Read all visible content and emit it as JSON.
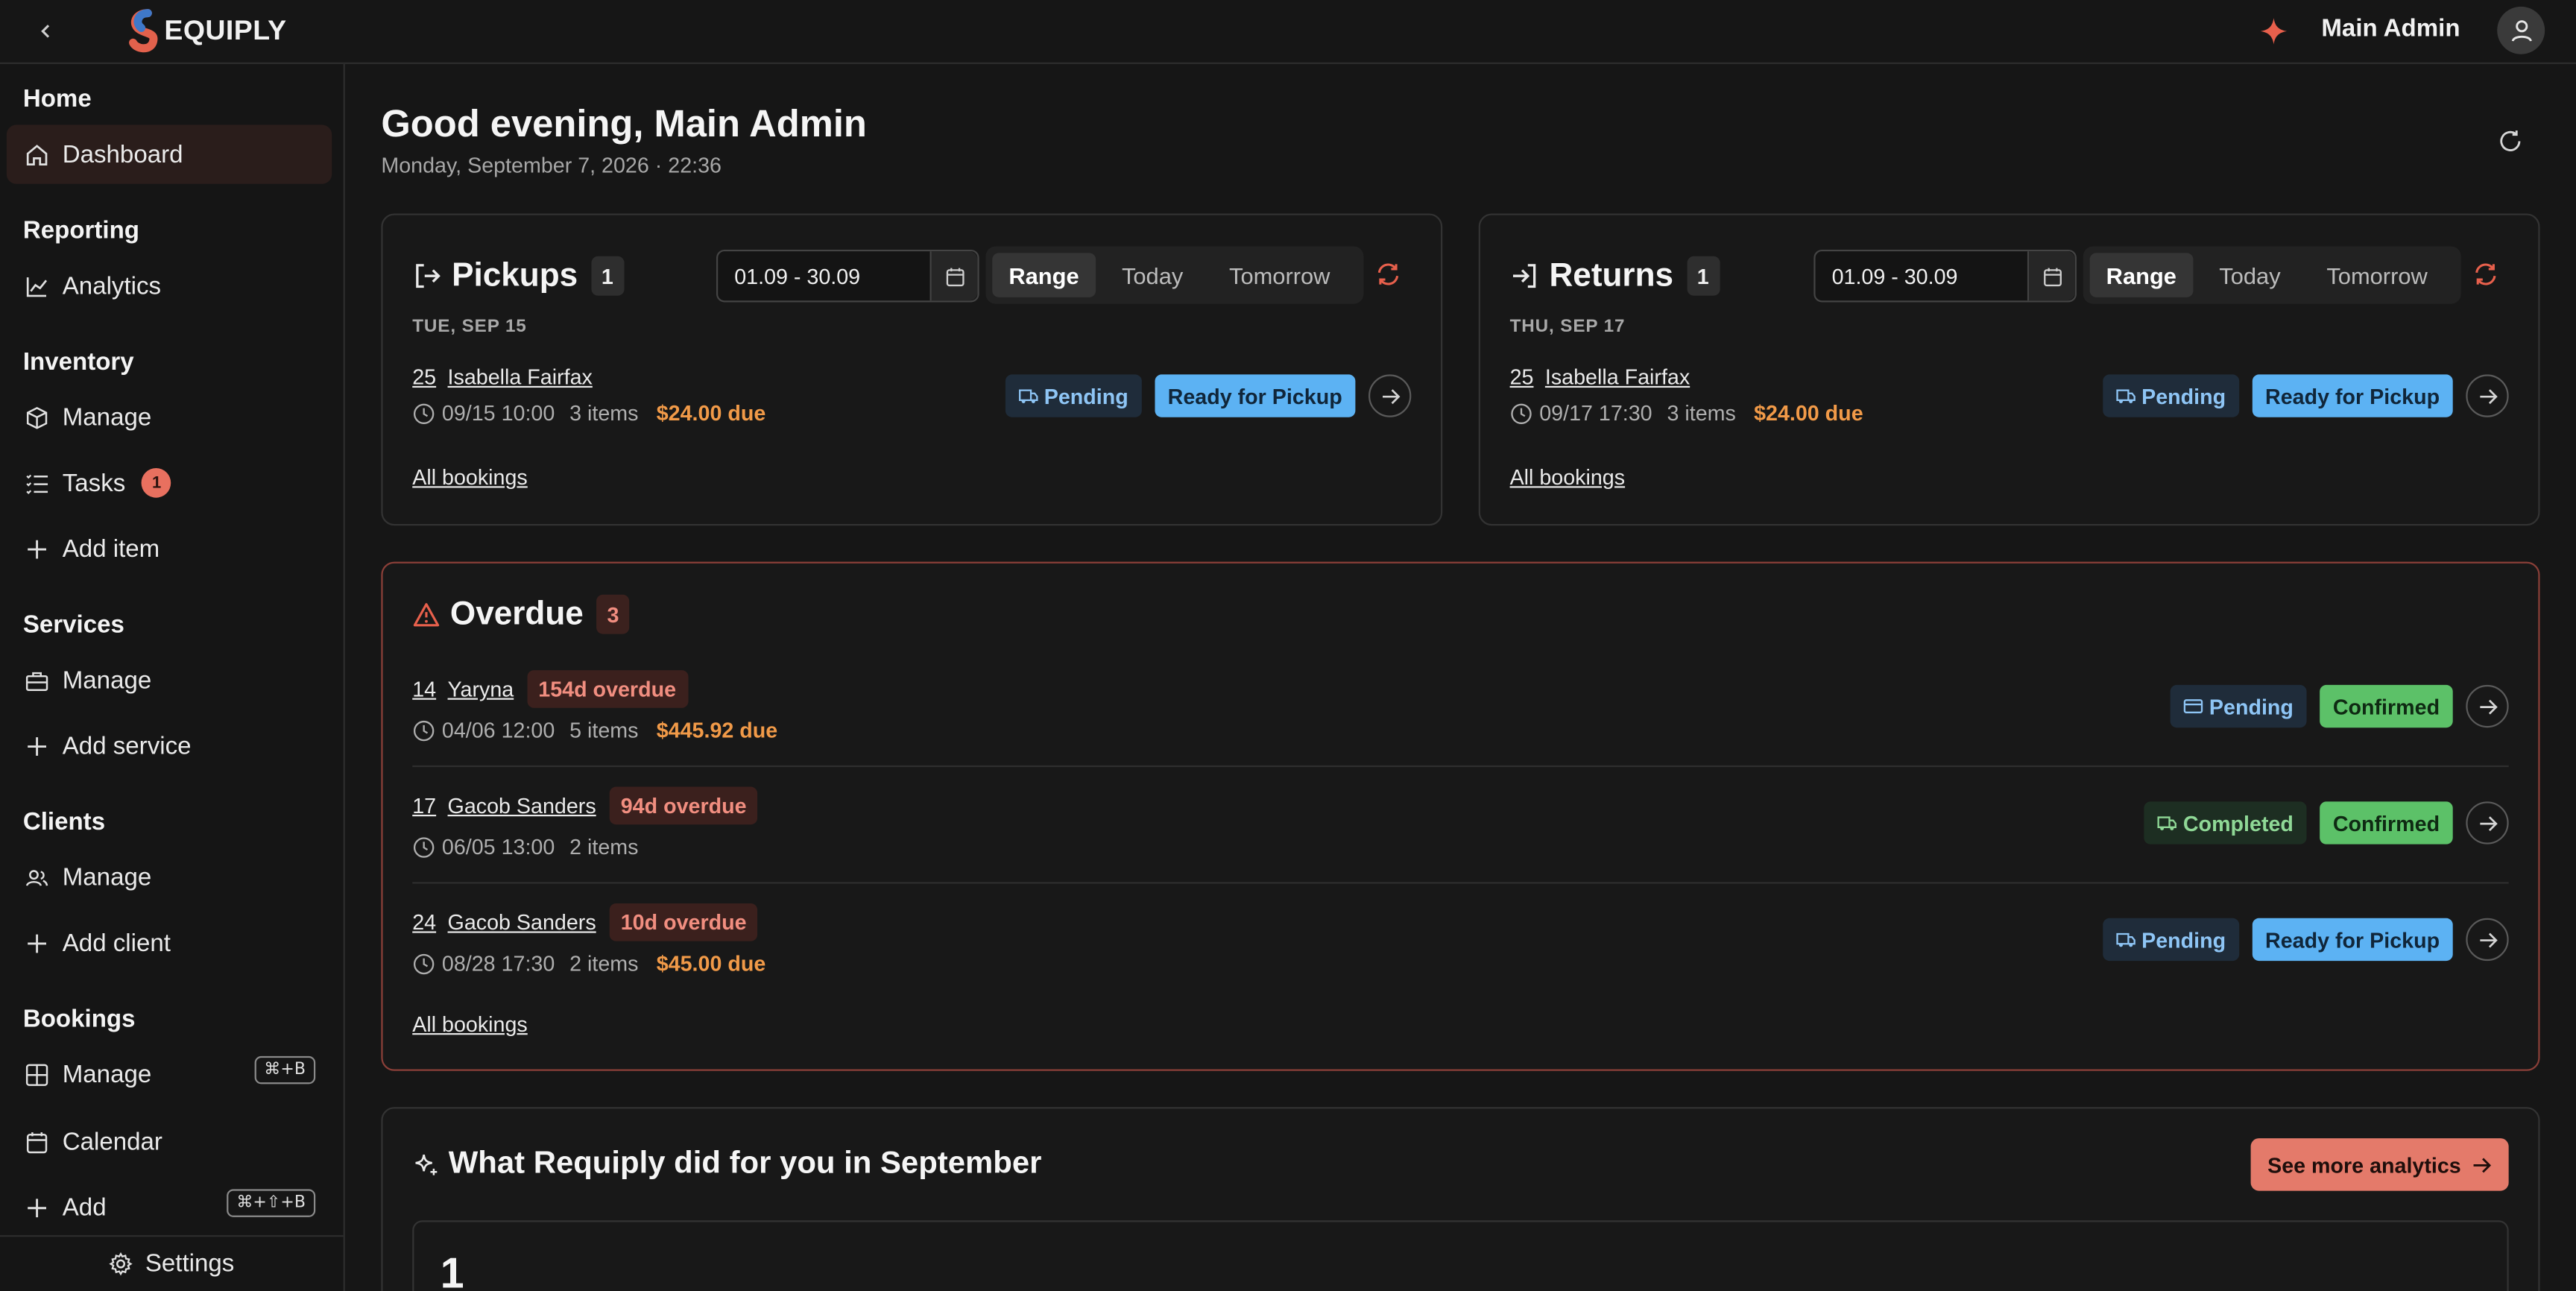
{
  "topbar": {
    "logo_text": "EQUIPLY",
    "user_name": "Main Admin"
  },
  "sidebar": {
    "sections": [
      {
        "title": "Home",
        "items": [
          {
            "label": "Dashboard",
            "icon": "home-icon"
          }
        ]
      },
      {
        "title": "Reporting",
        "items": [
          {
            "label": "Analytics",
            "icon": "chart-line-icon"
          }
        ]
      },
      {
        "title": "Inventory",
        "items": [
          {
            "label": "Manage",
            "icon": "box-icon"
          },
          {
            "label": "Tasks",
            "icon": "list-checks-icon",
            "badge": "1"
          },
          {
            "label": "Add item",
            "icon": "plus-icon"
          }
        ]
      },
      {
        "title": "Services",
        "items": [
          {
            "label": "Manage",
            "icon": "briefcase-icon"
          },
          {
            "label": "Add service",
            "icon": "plus-icon"
          }
        ]
      },
      {
        "title": "Clients",
        "items": [
          {
            "label": "Manage",
            "icon": "users-icon"
          },
          {
            "label": "Add client",
            "icon": "plus-icon"
          }
        ]
      },
      {
        "title": "Bookings",
        "items": [
          {
            "label": "Manage",
            "icon": "grid-icon",
            "shortcut": "⌘+B"
          },
          {
            "label": "Calendar",
            "icon": "calendar-icon"
          },
          {
            "label": "Add",
            "icon": "plus-icon",
            "shortcut": "⌘+⇧+B"
          }
        ]
      }
    ],
    "settings_label": "Settings"
  },
  "header": {
    "greeting": "Good evening, Main Admin",
    "date": "Monday, September 7, 2026 · 22:36"
  },
  "pickups": {
    "title": "Pickups",
    "count": "1",
    "range_value": "01.09 - 30.09",
    "segments": [
      "Range",
      "Today",
      "Tomorrow"
    ],
    "day_label": "TUE, SEP 15",
    "booking": {
      "id": "25",
      "client": "Isabella Fairfax",
      "time": "09/15 10:00",
      "items": "3 items",
      "due": "$24.00 due",
      "payment_status": "Pending",
      "status": "Ready for Pickup"
    },
    "all_link": "All bookings"
  },
  "returns": {
    "title": "Returns",
    "count": "1",
    "range_value": "01.09 - 30.09",
    "segments": [
      "Range",
      "Today",
      "Tomorrow"
    ],
    "day_label": "THU, SEP 17",
    "booking": {
      "id": "25",
      "client": "Isabella Fairfax",
      "time": "09/17 17:30",
      "items": "3 items",
      "due": "$24.00 due",
      "payment_status": "Pending",
      "status": "Ready for Pickup"
    },
    "all_link": "All bookings"
  },
  "overdue": {
    "title": "Overdue",
    "count": "3",
    "rows": [
      {
        "id": "14",
        "client": "Yaryna",
        "overdue": "154d overdue",
        "time": "04/06 12:00",
        "items": "5 items",
        "due": "$445.92 due",
        "payment_status": "Pending",
        "status": "Confirmed"
      },
      {
        "id": "17",
        "client": "Gacob Sanders",
        "overdue": "94d overdue",
        "time": "06/05 13:00",
        "items": "2 items",
        "due": "",
        "payment_status": "Completed",
        "status": "Confirmed"
      },
      {
        "id": "24",
        "client": "Gacob Sanders",
        "overdue": "10d overdue",
        "time": "08/28 17:30",
        "items": "2 items",
        "due": "$45.00 due",
        "payment_status": "Pending",
        "status": "Ready for Pickup"
      }
    ],
    "all_link": "All bookings"
  },
  "analytics": {
    "title": "What Requiply did for you in September",
    "button": "See more analytics",
    "stat_value": "1"
  },
  "colors": {
    "accent": "#e47a6a",
    "background": "#161616",
    "ready": "#5cb2f3",
    "confirmed": "#5cc168",
    "due": "#f19a48"
  }
}
